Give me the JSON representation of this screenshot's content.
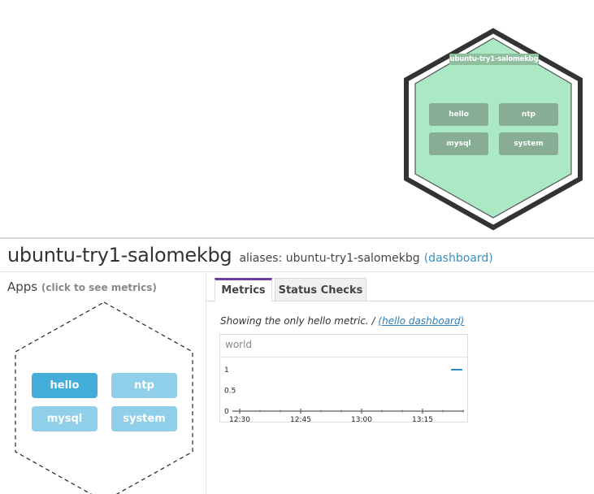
{
  "hostmap": {
    "host_label": "ubuntu-try1-salomekbg",
    "apps": [
      "hello",
      "ntp",
      "mysql",
      "system"
    ],
    "colors": {
      "hex_fill": "#abe9c4",
      "hex_outer": "#333333",
      "app_bg": "#87ae95"
    }
  },
  "host": {
    "name": "ubuntu-try1-salomekbg",
    "aliases_text": "aliases: ubuntu-try1-salomekbg",
    "dashboard_link": "(dashboard)"
  },
  "apps_panel": {
    "title": "Apps",
    "hint": "(click to see metrics)",
    "apps": [
      {
        "label": "hello",
        "selected": true,
        "color": "#44aedb"
      },
      {
        "label": "ntp",
        "selected": false,
        "color": "#8fcfe9"
      },
      {
        "label": "mysql",
        "selected": false,
        "color": "#8fcfe9"
      },
      {
        "label": "system",
        "selected": false,
        "color": "#8fcfe9"
      }
    ]
  },
  "tabs": [
    {
      "label": "Metrics",
      "active": true
    },
    {
      "label": "Status Checks",
      "active": false
    }
  ],
  "metric_info": {
    "text": "Showing the only hello metric. / ",
    "link": "(hello dashboard)"
  },
  "graph": {
    "title": "world"
  },
  "chart_data": {
    "type": "line",
    "title": "world",
    "x_ticks": [
      "12:30",
      "12:45",
      "13:00",
      "13:15"
    ],
    "y_ticks": [
      "1",
      "0.5",
      "0"
    ],
    "ylim": [
      0,
      1
    ],
    "series": [
      {
        "values": [
          1
        ],
        "color": "#2a8fc0"
      }
    ],
    "grid": false
  }
}
